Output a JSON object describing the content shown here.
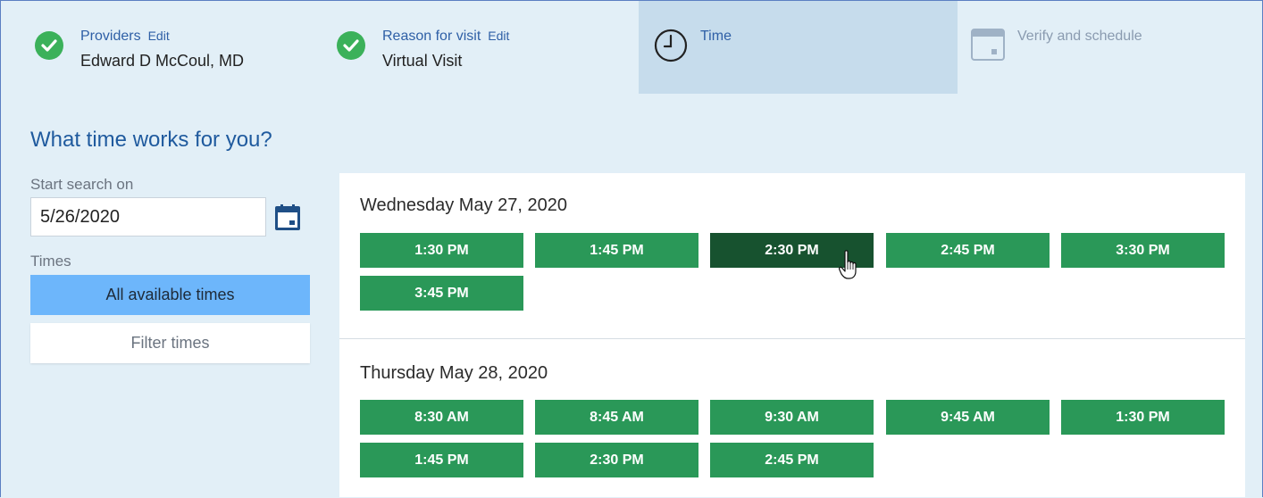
{
  "steps": [
    {
      "title": "Providers",
      "edit": "Edit",
      "value": "Edward D McCoul, MD",
      "state": "complete",
      "icon": "check-circle-icon"
    },
    {
      "title": "Reason for visit",
      "edit": "Edit",
      "value": "Virtual Visit",
      "state": "complete",
      "icon": "check-circle-icon"
    },
    {
      "title": "Time",
      "state": "current",
      "icon": "clock-icon"
    },
    {
      "title": "Verify and schedule",
      "state": "upcoming",
      "icon": "calendar-icon"
    }
  ],
  "heading": "What time works for you?",
  "search": {
    "label": "Start search on",
    "value": "5/26/2020",
    "calendar_icon": "calendar-icon"
  },
  "times_filter": {
    "label": "Times",
    "all_label": "All available times",
    "filter_label": "Filter times",
    "selected": "All available times"
  },
  "days": [
    {
      "title": "Wednesday May 27, 2020",
      "slots": [
        "1:30 PM",
        "1:45 PM",
        "2:30 PM",
        "2:45 PM",
        "3:30 PM",
        "3:45 PM"
      ],
      "hovered_slot": "2:30 PM"
    },
    {
      "title": "Thursday May 28, 2020",
      "slots": [
        "8:30 AM",
        "8:45 AM",
        "9:30 AM",
        "9:45 AM",
        "1:30 PM",
        "1:45 PM",
        "2:30 PM",
        "2:45 PM"
      ]
    }
  ],
  "colors": {
    "background": "#e2eff7",
    "slot": "#2a9858",
    "slot_hover": "#17522f",
    "active_filter": "#6db6fb",
    "check": "#3bb15a",
    "link": "#2e5fa6"
  }
}
